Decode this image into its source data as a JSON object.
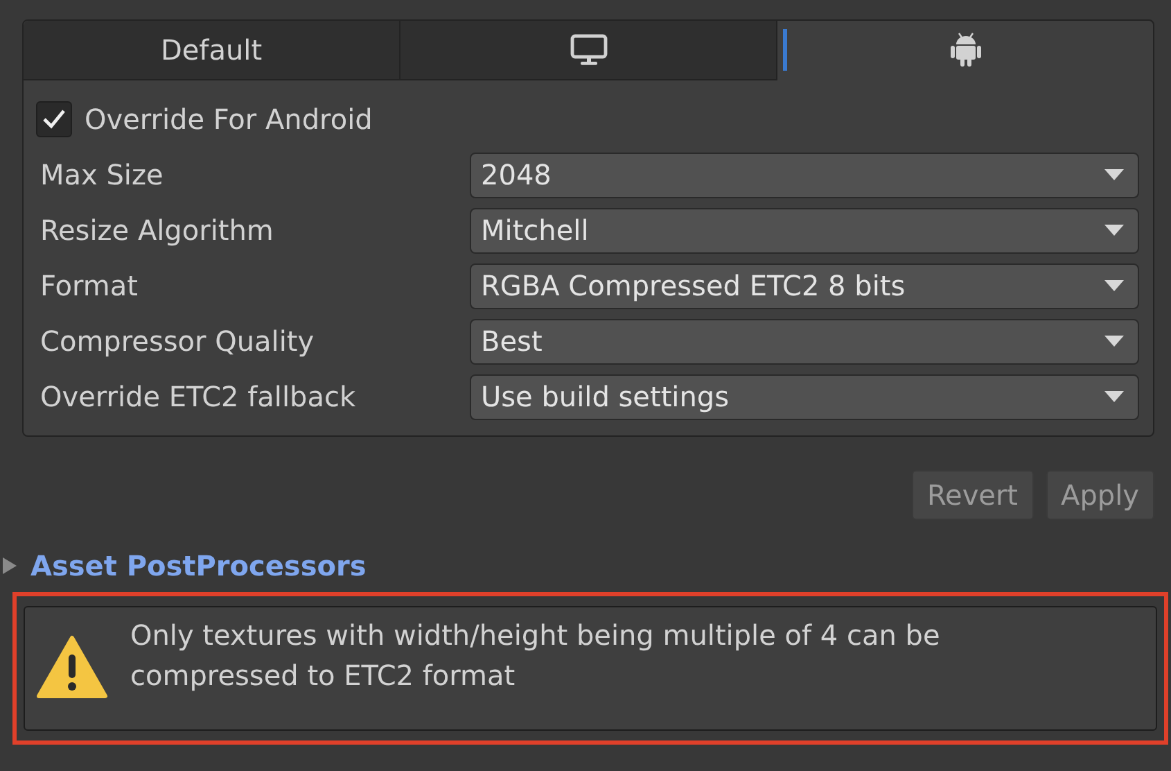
{
  "tabs": [
    {
      "kind": "text",
      "label": "Default",
      "selected": false
    },
    {
      "kind": "icon",
      "selected": false
    },
    {
      "kind": "icon",
      "selected": true
    }
  ],
  "override": {
    "label": "Override For Android",
    "checked": true
  },
  "settings": [
    {
      "label": "Max Size",
      "value": "2048"
    },
    {
      "label": "Resize Algorithm",
      "value": "Mitchell"
    },
    {
      "label": "Format",
      "value": "RGBA Compressed ETC2 8 bits"
    },
    {
      "label": "Compressor Quality",
      "value": "Best"
    },
    {
      "label": "Override ETC2 fallback",
      "value": "Use build settings"
    }
  ],
  "buttons": [
    "Revert",
    "Apply"
  ],
  "foldout": {
    "label": "Asset PostProcessors",
    "expanded": false
  },
  "help_box": {
    "message": "Only textures with width/height being multiple of 4 can be compressed to ETC2 format",
    "highlighted": true
  }
}
